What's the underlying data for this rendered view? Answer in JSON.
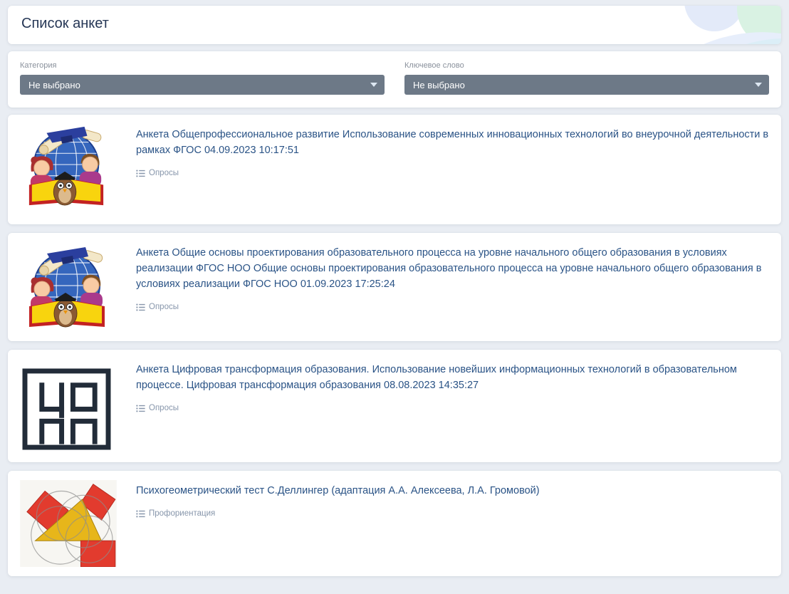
{
  "page_title": "Список анкет",
  "filters": {
    "category_label": "Категория",
    "category_value": "Не выбрано",
    "keyword_label": "Ключевое слово",
    "keyword_value": "Не выбрано"
  },
  "cards": [
    {
      "title": "Анкета Общепрофессиональное развитие Использование современных инновационных технологий во внеурочной деятельности в рамках ФГОС 04.09.2023 10:17:51",
      "category": "Опросы",
      "image": "education-globe-kids-owl"
    },
    {
      "title": "Анкета Общие основы проектирования образовательного процесса на уровне начального общего образования в условиях реализации ФГОС НОО Общие основы проектирования образовательного процесса на уровне начального общего образования в условиях реализации ФГОС НОО 01.09.2023 17:25:24",
      "category": "Опросы",
      "image": "education-globe-kids-owl"
    },
    {
      "title": "Анкета Цифровая трансформация образования. Использование новейших информационных технологий в образовательном процессе. Цифровая трансформация образования 08.08.2023 14:35:27",
      "category": "Опросы",
      "image": "copp-logo"
    },
    {
      "title": "Психогеометрический тест С.Деллингер (адаптация А.А. Алексеева, Л.А. Громовой)",
      "category": "Профориентация",
      "image": "psychogeometric-shapes"
    }
  ],
  "colors": {
    "page_bg": "#e9edf3",
    "header_title": "#253655",
    "card_title_link": "#2a5386",
    "select_bg": "#6d7987",
    "tag_text": "#8796ab"
  }
}
